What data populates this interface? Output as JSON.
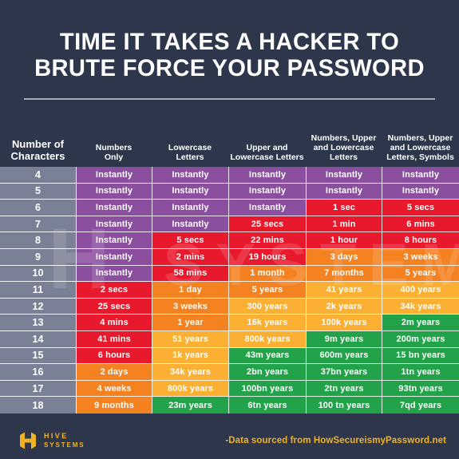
{
  "title": {
    "line1": "TIME IT TAKES A HACKER TO",
    "line2": "BRUTE FORCE YOUR PASSWORD"
  },
  "watermark": {
    "h": "H",
    "s": "SYSTEMS"
  },
  "footer": {
    "logo_line1": "HIVE",
    "logo_line2": "SYSTEMS",
    "source": "-Data sourced from HowSecureismyPassword.net",
    "logo_icon": "hive-hexagon-h-logo"
  },
  "colors": {
    "background": "#2e364b",
    "gray": "#7a8196",
    "purple": "#8c4f9f",
    "red": "#e8192c",
    "orange": "#f58220",
    "amber": "#fbb034",
    "green": "#22a34a",
    "accent_gold": "#f0b323"
  },
  "table": {
    "headers": [
      "Number of Characters",
      "Numbers Only",
      "Lowercase Letters",
      "Upper and Lowercase Letters",
      "Numbers, Upper and Lowercase Letters",
      "Numbers, Upper and Lowercase Letters, Symbols"
    ],
    "header_lines": [
      [
        "Number of",
        "Characters"
      ],
      [
        "Numbers",
        "Only"
      ],
      [
        "Lowercase",
        "Letters"
      ],
      [
        "Upper and",
        "Lowercase Letters"
      ],
      [
        "Numbers, Upper",
        "and Lowercase",
        "Letters"
      ],
      [
        "Numbers, Upper",
        "and Lowercase",
        "Letters, Symbols"
      ]
    ],
    "rows": [
      {
        "chars": "4",
        "cells": [
          {
            "t": "Instantly",
            "c": "purple"
          },
          {
            "t": "Instantly",
            "c": "purple"
          },
          {
            "t": "Instantly",
            "c": "purple"
          },
          {
            "t": "Instantly",
            "c": "purple"
          },
          {
            "t": "Instantly",
            "c": "purple"
          }
        ]
      },
      {
        "chars": "5",
        "cells": [
          {
            "t": "Instantly",
            "c": "purple"
          },
          {
            "t": "Instantly",
            "c": "purple"
          },
          {
            "t": "Instantly",
            "c": "purple"
          },
          {
            "t": "Instantly",
            "c": "purple"
          },
          {
            "t": "Instantly",
            "c": "purple"
          }
        ]
      },
      {
        "chars": "6",
        "cells": [
          {
            "t": "Instantly",
            "c": "purple"
          },
          {
            "t": "Instantly",
            "c": "purple"
          },
          {
            "t": "Instantly",
            "c": "purple"
          },
          {
            "t": "1 sec",
            "c": "red"
          },
          {
            "t": "5 secs",
            "c": "red"
          }
        ]
      },
      {
        "chars": "7",
        "cells": [
          {
            "t": "Instantly",
            "c": "purple"
          },
          {
            "t": "Instantly",
            "c": "purple"
          },
          {
            "t": "25 secs",
            "c": "red"
          },
          {
            "t": "1 min",
            "c": "red"
          },
          {
            "t": "6 mins",
            "c": "red"
          }
        ]
      },
      {
        "chars": "8",
        "cells": [
          {
            "t": "Instantly",
            "c": "purple"
          },
          {
            "t": "5 secs",
            "c": "red"
          },
          {
            "t": "22 mins",
            "c": "red"
          },
          {
            "t": "1 hour",
            "c": "red"
          },
          {
            "t": "8 hours",
            "c": "red"
          }
        ]
      },
      {
        "chars": "9",
        "cells": [
          {
            "t": "Instantly",
            "c": "purple"
          },
          {
            "t": "2 mins",
            "c": "red"
          },
          {
            "t": "19 hours",
            "c": "red"
          },
          {
            "t": "3 days",
            "c": "orange"
          },
          {
            "t": "3 weeks",
            "c": "orange"
          }
        ]
      },
      {
        "chars": "10",
        "cells": [
          {
            "t": "Instantly",
            "c": "purple"
          },
          {
            "t": "58 mins",
            "c": "red"
          },
          {
            "t": "1 month",
            "c": "orange"
          },
          {
            "t": "7 months",
            "c": "orange"
          },
          {
            "t": "5 years",
            "c": "orange"
          }
        ]
      },
      {
        "chars": "11",
        "cells": [
          {
            "t": "2 secs",
            "c": "red"
          },
          {
            "t": "1 day",
            "c": "orange"
          },
          {
            "t": "5 years",
            "c": "orange"
          },
          {
            "t": "41 years",
            "c": "amber"
          },
          {
            "t": "400 years",
            "c": "amber"
          }
        ]
      },
      {
        "chars": "12",
        "cells": [
          {
            "t": "25 secs",
            "c": "red"
          },
          {
            "t": "3 weeks",
            "c": "orange"
          },
          {
            "t": "300 years",
            "c": "amber"
          },
          {
            "t": "2k years",
            "c": "amber"
          },
          {
            "t": "34k years",
            "c": "amber"
          }
        ]
      },
      {
        "chars": "13",
        "cells": [
          {
            "t": "4 mins",
            "c": "red"
          },
          {
            "t": "1 year",
            "c": "orange"
          },
          {
            "t": "16k years",
            "c": "amber"
          },
          {
            "t": "100k years",
            "c": "amber"
          },
          {
            "t": "2m years",
            "c": "green"
          }
        ]
      },
      {
        "chars": "14",
        "cells": [
          {
            "t": "41 mins",
            "c": "red"
          },
          {
            "t": "51 years",
            "c": "amber"
          },
          {
            "t": "800k years",
            "c": "amber"
          },
          {
            "t": "9m years",
            "c": "green"
          },
          {
            "t": "200m years",
            "c": "green"
          }
        ]
      },
      {
        "chars": "15",
        "cells": [
          {
            "t": "6 hours",
            "c": "red"
          },
          {
            "t": "1k years",
            "c": "amber"
          },
          {
            "t": "43m years",
            "c": "green"
          },
          {
            "t": "600m years",
            "c": "green"
          },
          {
            "t": "15 bn years",
            "c": "green"
          }
        ]
      },
      {
        "chars": "16",
        "cells": [
          {
            "t": "2 days",
            "c": "orange"
          },
          {
            "t": "34k years",
            "c": "amber"
          },
          {
            "t": "2bn years",
            "c": "green"
          },
          {
            "t": "37bn years",
            "c": "green"
          },
          {
            "t": "1tn years",
            "c": "green"
          }
        ]
      },
      {
        "chars": "17",
        "cells": [
          {
            "t": "4 weeks",
            "c": "orange"
          },
          {
            "t": "800k years",
            "c": "amber"
          },
          {
            "t": "100bn years",
            "c": "green"
          },
          {
            "t": "2tn years",
            "c": "green"
          },
          {
            "t": "93tn years",
            "c": "green"
          }
        ]
      },
      {
        "chars": "18",
        "cells": [
          {
            "t": "9 months",
            "c": "orange"
          },
          {
            "t": "23m years",
            "c": "green"
          },
          {
            "t": "6tn years",
            "c": "green"
          },
          {
            "t": "100 tn years",
            "c": "green"
          },
          {
            "t": "7qd years",
            "c": "green"
          }
        ]
      }
    ]
  }
}
